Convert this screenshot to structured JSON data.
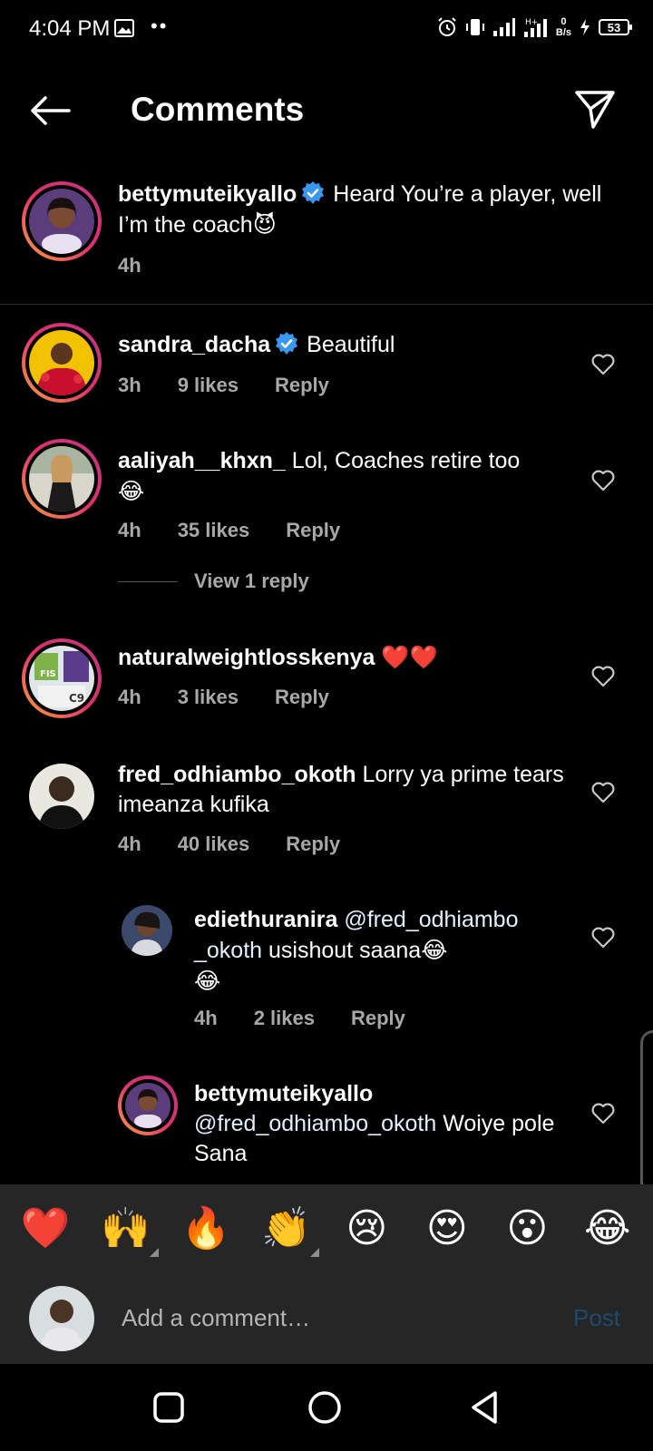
{
  "status_bar": {
    "time": "4:04 PM",
    "speed_value": "0",
    "speed_unit": "B/s",
    "battery": "53"
  },
  "header": {
    "title": "Comments"
  },
  "caption": {
    "username": "bettymuteikyallo",
    "verified": true,
    "text": "Heard You’re a player, well I’m the coach",
    "emoji": "😈",
    "time": "4h"
  },
  "comments": [
    {
      "username": "sandra_dacha",
      "verified": true,
      "text": "Beautiful",
      "time": "3h",
      "likes": "9 likes",
      "reply": "Reply"
    },
    {
      "username": "aaliyah__khxn_",
      "verified": false,
      "text": "Lol, Coaches retire too",
      "emoji": "😂",
      "time": "4h",
      "likes": "35 likes",
      "reply": "Reply"
    },
    {
      "username": "naturalweightlosskenya",
      "verified": false,
      "text": "",
      "emoji": "❤️❤️",
      "time": "4h",
      "likes": "3 likes",
      "reply": "Reply"
    },
    {
      "username": "fred_odhiambo_okoth",
      "verified": false,
      "text": "Lorry ya prime tears imeanza kufika",
      "time": "4h",
      "likes": "40 likes",
      "reply": "Reply"
    }
  ],
  "view_replies": "View 1 reply",
  "replies": [
    {
      "username": "ediethuranira",
      "mention": "@fred_odhiambo _okoth",
      "text": "usishout saana",
      "emoji": "😂",
      "emoji2": "😂",
      "time": "4h",
      "likes": "2 likes",
      "reply": "Reply"
    },
    {
      "username": "bettymuteikyallo",
      "mention": "@fred_odhiambo_okoth",
      "text": "Woiye pole Sana"
    }
  ],
  "emoji_bar": [
    "❤️",
    "🙌",
    "🔥",
    "👏",
    "😢",
    "😍",
    "😮",
    "😂"
  ],
  "composer": {
    "placeholder": "Add a comment…",
    "post_label": "Post"
  },
  "colors": {
    "background": "#000000",
    "secondary_text": "#a8a8a8",
    "verified_blue": "#3897f0",
    "post_disabled": "#1c4a6e",
    "bar_background": "#262626"
  }
}
